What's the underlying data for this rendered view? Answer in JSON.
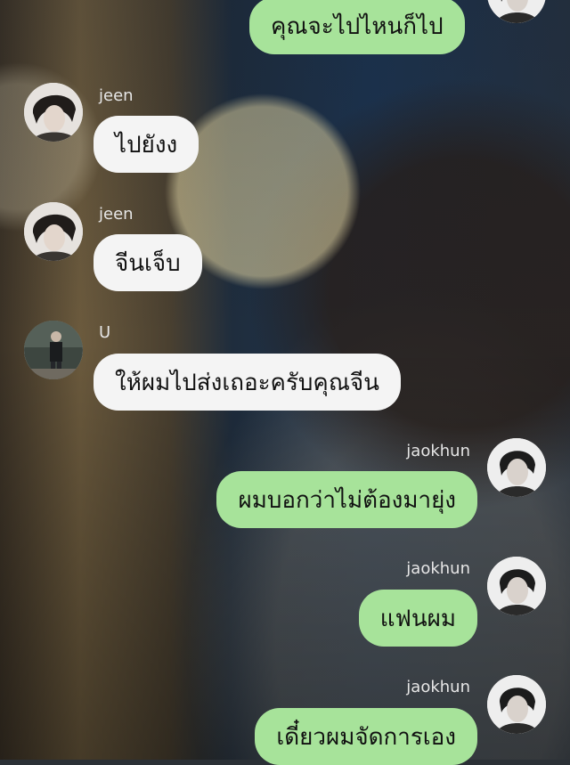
{
  "messages": [
    {
      "side": "out",
      "sender": "",
      "text": "คุณจะไปไหนก็ไป"
    },
    {
      "side": "in",
      "sender": "jeen",
      "text": "ไปยังง"
    },
    {
      "side": "in",
      "sender": "jeen",
      "text": "จีนเจ็บ"
    },
    {
      "side": "in",
      "sender": "U",
      "text": "ให้ผมไปส่งเถอะครับคุณจีน"
    },
    {
      "side": "out",
      "sender": "jaokhun",
      "text": "ผมบอกว่าไม่ต้องมายุ่ง"
    },
    {
      "side": "out",
      "sender": "jaokhun",
      "text": "แฟนผม"
    },
    {
      "side": "out",
      "sender": "jaokhun",
      "text": "เดี๋ยวผมจัดการเอง"
    }
  ],
  "colors": {
    "outgoing_bubble": "#a7e39a",
    "incoming_bubble": "#f4f4f4",
    "name_text": "#e6e6e6"
  },
  "icons": {
    "jeen": "person-photo-avatar",
    "U": "person-standing-photo-avatar",
    "jaokhun": "person-photo-avatar"
  }
}
